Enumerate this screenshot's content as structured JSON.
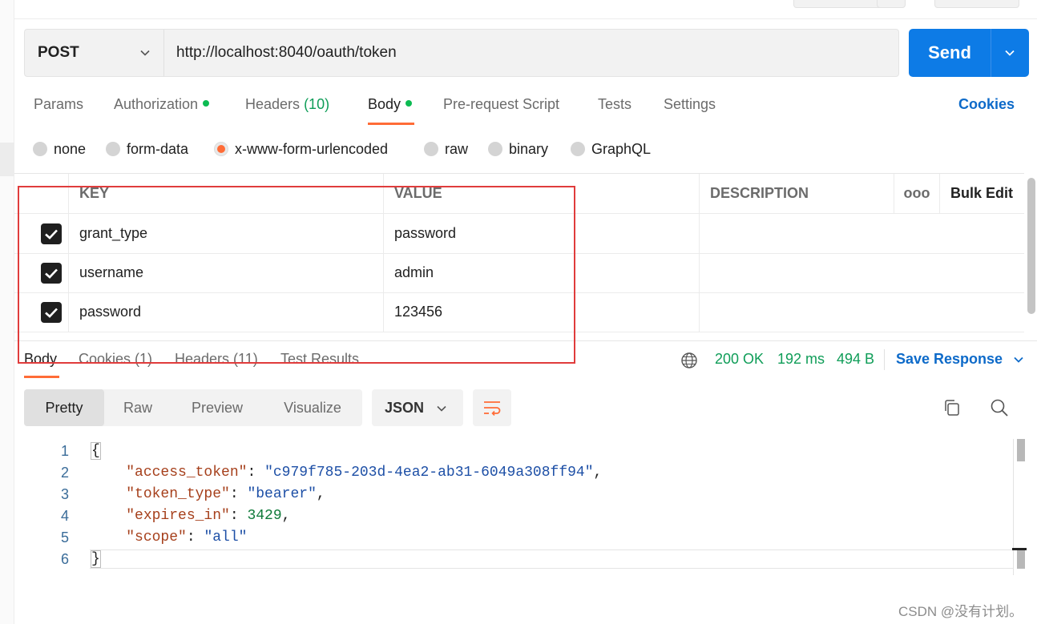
{
  "request": {
    "method": "POST",
    "url": "http://localhost:8040/oauth/token",
    "send_label": "Send"
  },
  "request_tabs": [
    {
      "label": "Params"
    },
    {
      "label": "Authorization",
      "dot": true
    },
    {
      "label": "Headers",
      "count": "(10)"
    },
    {
      "label": "Body",
      "dot": true,
      "active": true
    },
    {
      "label": "Pre-request Script"
    },
    {
      "label": "Tests"
    },
    {
      "label": "Settings"
    }
  ],
  "cookies_label": "Cookies",
  "body_types": [
    {
      "label": "none"
    },
    {
      "label": "form-data"
    },
    {
      "label": "x-www-form-urlencoded",
      "selected": true
    },
    {
      "label": "raw"
    },
    {
      "label": "binary"
    },
    {
      "label": "GraphQL"
    }
  ],
  "kv_table": {
    "headers": {
      "key": "KEY",
      "value": "VALUE",
      "description": "DESCRIPTION",
      "more": "ooo",
      "bulk_edit": "Bulk Edit"
    },
    "rows": [
      {
        "checked": true,
        "key": "grant_type",
        "value": "password",
        "description": ""
      },
      {
        "checked": true,
        "key": "username",
        "value": "admin",
        "description": ""
      },
      {
        "checked": true,
        "key": "password",
        "value": "123456",
        "description": ""
      }
    ]
  },
  "response_tabs": [
    {
      "label": "Body",
      "active": true
    },
    {
      "label": "Cookies (1)"
    },
    {
      "label": "Headers (11)"
    },
    {
      "label": "Test Results"
    }
  ],
  "response_status": {
    "status": "200 OK",
    "time": "192 ms",
    "size": "494 B",
    "save_label": "Save Response"
  },
  "view_modes": [
    {
      "label": "Pretty",
      "active": true
    },
    {
      "label": "Raw"
    },
    {
      "label": "Preview"
    },
    {
      "label": "Visualize"
    }
  ],
  "format": "JSON",
  "code_lines": [
    {
      "n": "1",
      "text": "{"
    },
    {
      "n": "2",
      "key": "\"access_token\"",
      "value": "\"c979f785-203d-4ea2-ab31-6049a308ff94\"",
      "type": "string",
      "trail": ","
    },
    {
      "n": "3",
      "key": "\"token_type\"",
      "value": "\"bearer\"",
      "type": "string",
      "trail": ","
    },
    {
      "n": "4",
      "key": "\"expires_in\"",
      "value": "3429",
      "type": "number",
      "trail": ","
    },
    {
      "n": "5",
      "key": "\"scope\"",
      "value": "\"all\"",
      "type": "string",
      "trail": ""
    },
    {
      "n": "6",
      "text": "}"
    }
  ],
  "watermark": "CSDN @没有计划。",
  "colors": {
    "accent": "#ff6c37",
    "send": "#0d7be6",
    "link": "#0d6ac9",
    "status_ok": "#0f9d58",
    "annotation_box": "#e03c3c"
  }
}
